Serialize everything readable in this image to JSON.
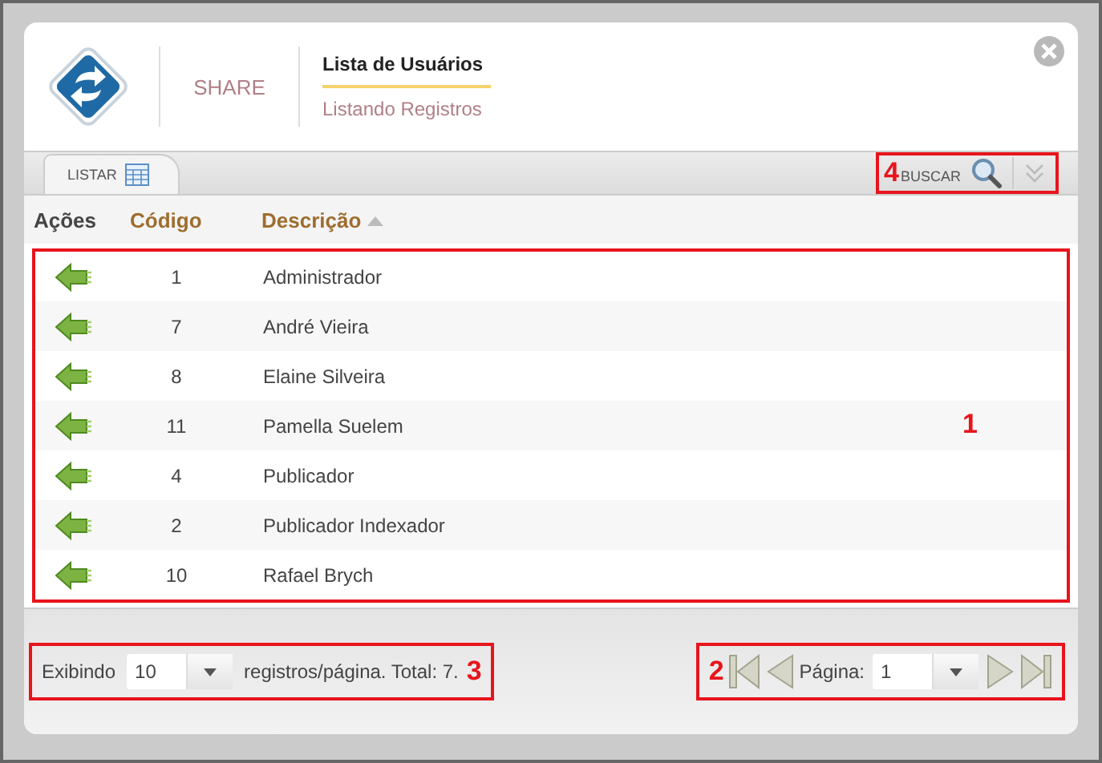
{
  "header": {
    "brand": "SHARE",
    "title": "Lista de Usuários",
    "subtitle": "Listando Registros"
  },
  "tabs": [
    {
      "label": "LISTAR",
      "selected": true
    }
  ],
  "search": {
    "label": "BUSCAR",
    "annotation": "4"
  },
  "table": {
    "columns": [
      {
        "label": "Ações",
        "sorted": false
      },
      {
        "label": "Código",
        "sorted": false
      },
      {
        "label": "Descrição",
        "sorted": true
      }
    ],
    "annotation": "1",
    "rows": [
      {
        "code": "1",
        "description": "Administrador"
      },
      {
        "code": "7",
        "description": "André Vieira"
      },
      {
        "code": "8",
        "description": "Elaine Silveira"
      },
      {
        "code": "11",
        "description": "Pamella Suelem"
      },
      {
        "code": "4",
        "description": "Publicador"
      },
      {
        "code": "2",
        "description": "Publicador Indexador"
      },
      {
        "code": "10",
        "description": "Rafael Brych"
      }
    ]
  },
  "page_size": {
    "prefix": "Exibindo",
    "value": "10",
    "suffix": "registros/página. Total: 7.",
    "annotation": "3"
  },
  "pager": {
    "label": "Página:",
    "value": "1",
    "annotation": "2"
  }
}
